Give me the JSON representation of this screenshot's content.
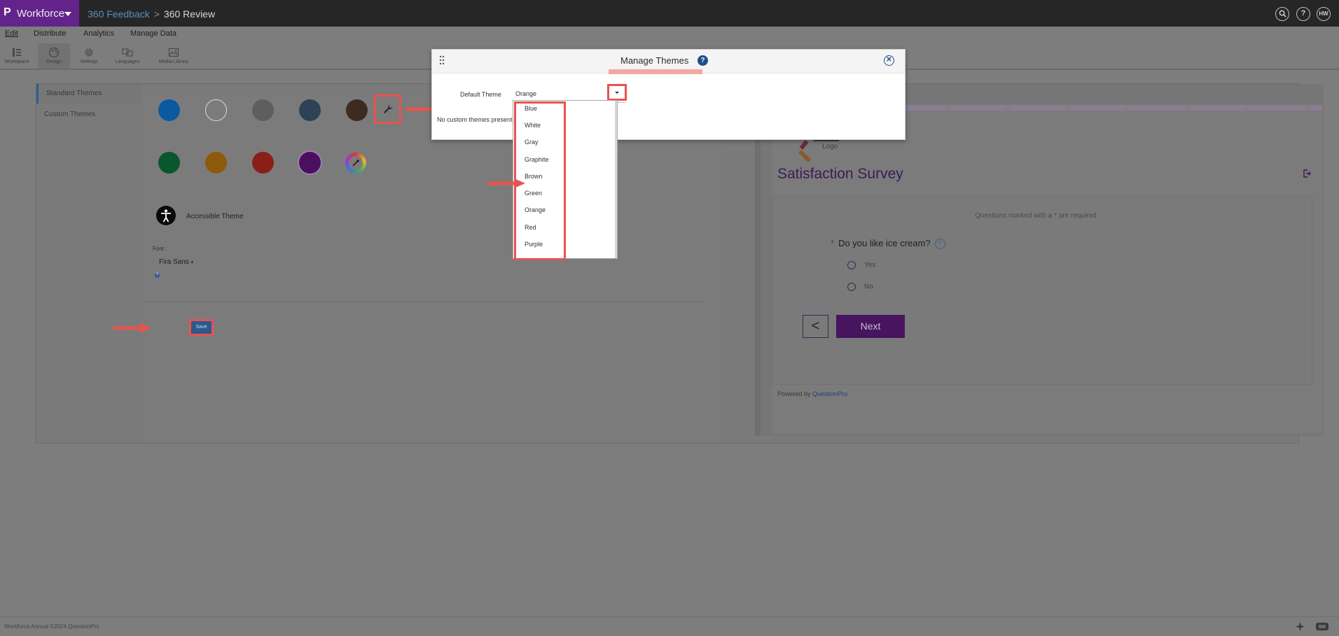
{
  "app": {
    "brand": "Workforce",
    "breadcrumb": [
      "360 Feedback",
      "360 Review"
    ],
    "breadcrumb_separator": ">",
    "top_icons": [
      "search-icon",
      "help-icon"
    ],
    "user_initials": "HW"
  },
  "menu": [
    "Edit",
    "Distribute",
    "Analytics",
    "Manage Data"
  ],
  "toolbar": [
    "Workspace",
    "Design",
    "Settings",
    "Languages",
    "Media Library"
  ],
  "left_nav": [
    "Standard Themes",
    "Custom Themes"
  ],
  "theme_colors": {
    "row1": [
      "#0b59a0",
      "#7b7b7b",
      "#5e5e5e",
      "#2d4255",
      "#3e2a21"
    ],
    "row2": [
      "#0a572d",
      "#8c5a08",
      "#8a1f18",
      "#4a0f60"
    ],
    "annotation": "#e8534f"
  },
  "accessible_theme_label": "Accessible Theme",
  "font": {
    "label": "Font :",
    "value": "Fira Sans",
    "help": "?"
  },
  "save_label": "Save",
  "preview": {
    "logo_text": "Logo",
    "title": "Satisfaction Survey",
    "required_note": "Questions marked with a * are required",
    "question": "Do you like ice cream?",
    "required_star": "*",
    "question_help": "?",
    "options": [
      "Yes",
      "No"
    ],
    "back_symbol": "<",
    "next_label": "Next",
    "powered_by": "Powered by",
    "powered_brand": "QuestionPro"
  },
  "footer": "Workforce Annual ©2024 QuestionPro",
  "modal": {
    "title": "Manage Themes",
    "help": "?",
    "close": "✕",
    "default_theme_label": "Default Theme",
    "selected_value": "Orange",
    "no_custom_text": "No custom themes present",
    "options": [
      "Blue",
      "White",
      "Gray",
      "Graphite",
      "Brown",
      "Green",
      "Orange",
      "Red",
      "Purple"
    ]
  }
}
